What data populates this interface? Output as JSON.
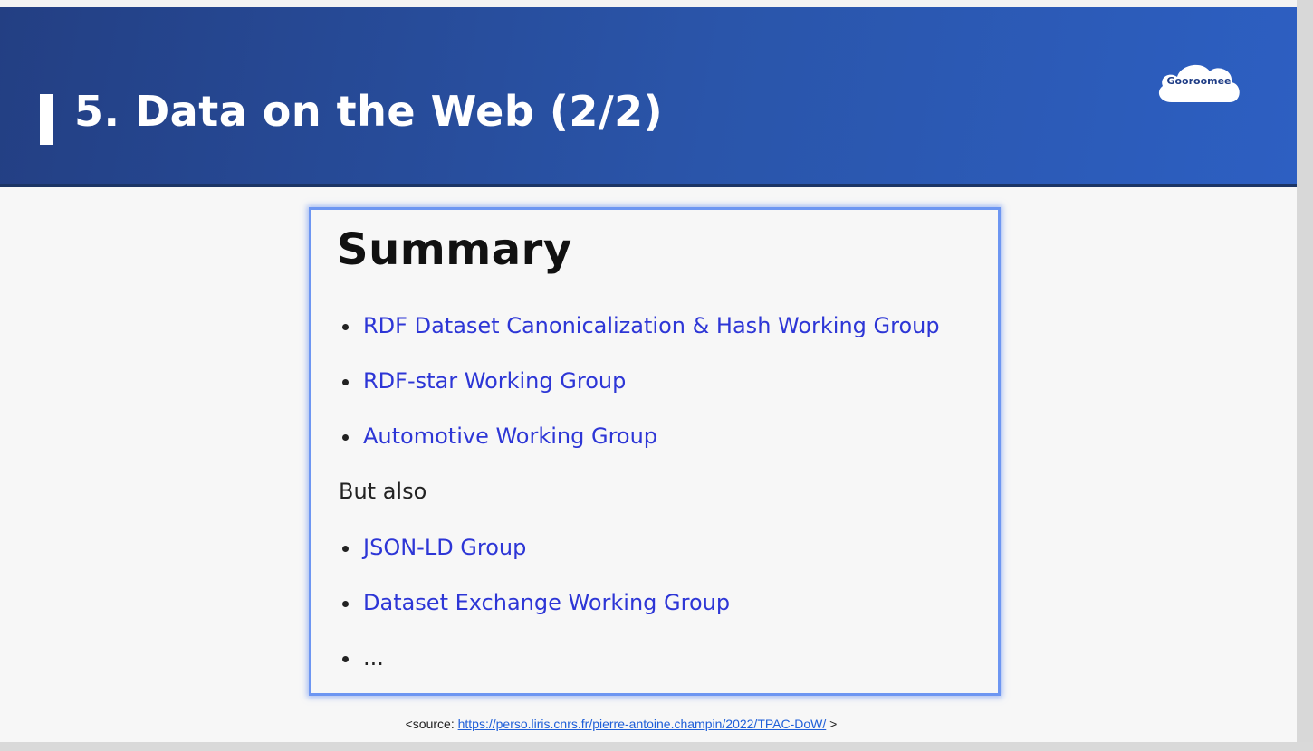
{
  "slide": {
    "title": "5. Data on the Web (2/2)",
    "logo_text": "Gooroomee"
  },
  "panel": {
    "heading": "Summary",
    "groups": [
      "RDF Dataset Canonicalization & Hash Working Group",
      "RDF-star Working Group",
      "Automotive Working Group"
    ],
    "but_also": "But also",
    "other_groups": [
      "JSON-LD Group",
      "Dataset Exchange Working Group"
    ],
    "ellipsis": "..."
  },
  "source": {
    "prefix": "<source: ",
    "url": "https://perso.liris.cnrs.fr/pierre-antoine.champin/2022/TPAC-DoW/",
    "suffix": " >"
  },
  "colors": {
    "header": "#2a55aa",
    "link": "#2d36d6",
    "panel_border": "#6d96f2"
  }
}
